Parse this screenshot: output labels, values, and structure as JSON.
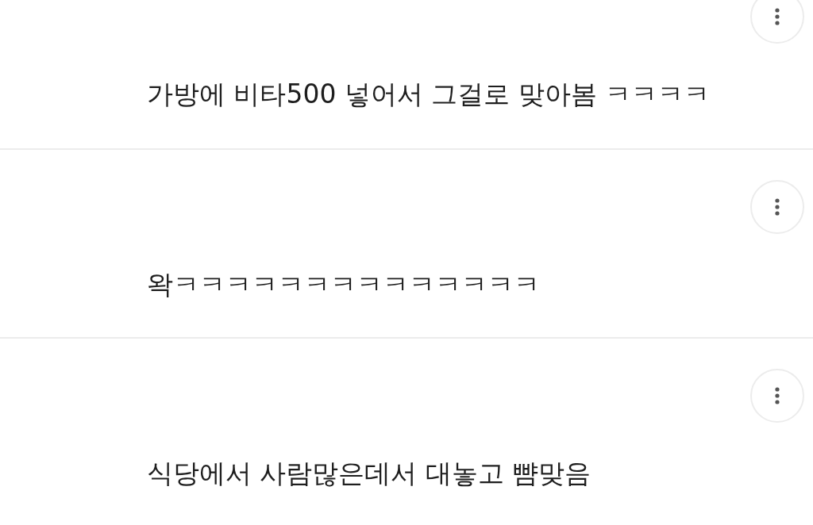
{
  "comments": [
    {
      "text": "가방에 비타500 넣어서 그걸로 맞아봄 ㅋㅋㅋㅋ"
    },
    {
      "text": "왁ㅋㅋㅋㅋㅋㅋㅋㅋㅋㅋㅋㅋㅋㅋ"
    },
    {
      "text": "식당에서 사람많은데서 대놓고 뺨맞음"
    }
  ]
}
